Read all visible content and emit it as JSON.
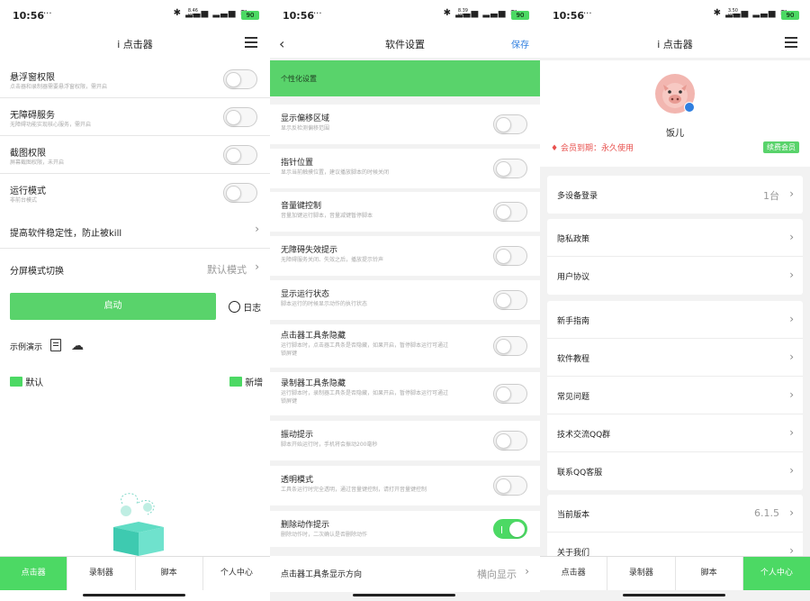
{
  "status_bar": [
    {
      "time": "10:56",
      "extra": "···",
      "net_speed": "8.46",
      "net_unit": "KB/s",
      "battery": "90"
    },
    {
      "time": "10:56",
      "extra": "···",
      "net_speed": "8.39",
      "net_unit": "KB/s",
      "battery": "90"
    },
    {
      "time": "10:56",
      "extra": "···",
      "net_speed": "3.50",
      "net_unit": "KB/s",
      "battery": "90"
    }
  ],
  "panel1": {
    "title": "i 点击器",
    "rows": [
      {
        "title": "悬浮窗权限",
        "subtitle": "点击器和录制器需要悬浮窗权限，需开启",
        "on": false
      },
      {
        "title": "无障碍服务",
        "subtitle": "无障碍功能实现核心服务，需开启",
        "on": false
      },
      {
        "title": "截图权限",
        "subtitle": "屏幕截图权限，未开启",
        "on": false
      },
      {
        "title": "运行模式",
        "subtitle": "非前台模式",
        "on": false
      }
    ],
    "stability_label": "提高软件稳定性，防止被kill",
    "split_label": "分屏模式切换",
    "split_value": "默认模式",
    "start_label": "启动",
    "log_label": "日志",
    "demo_label": "示例演示",
    "folder_default": "默认",
    "folder_new": "新增",
    "tabs": [
      "点击器",
      "录制器",
      "脚本",
      "个人中心"
    ]
  },
  "panel2": {
    "title": "软件设置",
    "save_label": "保存",
    "section_label": "个性化设置",
    "rows": [
      {
        "title": "显示偏移区域",
        "subtitle": "显示反检测偏移范围",
        "on": false
      },
      {
        "title": "指针位置",
        "subtitle": "显示当前触摸位置，建议播放脚本的时候关闭",
        "on": false
      },
      {
        "title": "音量键控制",
        "subtitle": "音量加键运行脚本，音量减键暂停脚本",
        "on": false
      },
      {
        "title": "无障碍失效提示",
        "subtitle": "无障碍服务关闭、失效之后，播放提示铃声",
        "on": false
      },
      {
        "title": "显示运行状态",
        "subtitle": "脚本运行的时候显示动作的执行状态",
        "on": false
      },
      {
        "title": "点击器工具条隐藏",
        "subtitle": "运行脚本时，点击器工具条是否隐藏，如果开启，暂停脚本运行可通过",
        "subtitle2": "锁屏键",
        "on": false
      },
      {
        "title": "录制器工具条隐藏",
        "subtitle": "运行脚本时，录制器工具条是否隐藏，如果开启，暂停脚本运行可通过",
        "subtitle2": "锁屏键",
        "on": false
      },
      {
        "title": "振动提示",
        "subtitle": "脚本开始运行时，手机将会振动200毫秒",
        "on": false
      },
      {
        "title": "透明模式",
        "subtitle": "工具条运行时完全透明，通过音量键控制，请打开音量键控制",
        "on": false
      },
      {
        "title": "删除动作提示",
        "subtitle": "删除动作时，二次确认是否删除动作",
        "on": true
      }
    ],
    "direction_label": "点击器工具条显示方向",
    "direction_value": "横向显示"
  },
  "panel3": {
    "title": "i 点击器",
    "username": "饭儿",
    "member_label": "会员到期：永久使用",
    "renew_label": "续费会员",
    "group1": [
      {
        "label": "多设备登录",
        "value": "1台"
      }
    ],
    "group2": [
      {
        "label": "隐私政策"
      },
      {
        "label": "用户协议"
      }
    ],
    "group3": [
      {
        "label": "新手指南"
      },
      {
        "label": "软件教程"
      },
      {
        "label": "常见问题"
      },
      {
        "label": "技术交流QQ群"
      },
      {
        "label": "联系QQ客服"
      }
    ],
    "group4": [
      {
        "label": "当前版本",
        "value": "6.1.5"
      },
      {
        "label": "关于我们"
      }
    ],
    "tabs": [
      "点击器",
      "录制器",
      "脚本",
      "个人中心"
    ]
  },
  "colors": {
    "accent": "#4cd964",
    "header_green": "#59d36b",
    "link_blue": "#2f7fe0",
    "member_red": "#e8514e"
  }
}
